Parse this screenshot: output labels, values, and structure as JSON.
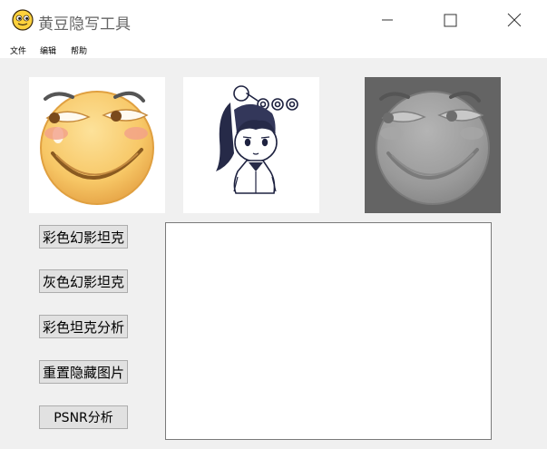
{
  "window": {
    "title": "黄豆隐写工具",
    "icon": "smiley-face-icon",
    "controls": [
      "minimize-icon",
      "maximize-icon",
      "close-icon"
    ]
  },
  "menu": {
    "items": [
      {
        "label": "文件"
      },
      {
        "label": "编辑"
      },
      {
        "label": "帮助"
      }
    ]
  },
  "images": [
    {
      "name": "cover-image-color-smiley",
      "icon": "smirk-emoji"
    },
    {
      "name": "hidden-image-anime-character",
      "icon": "anime-girl-sketch"
    },
    {
      "name": "result-image-gray-smiley",
      "icon": "smirk-emoji-gray"
    }
  ],
  "buttons": [
    {
      "label": "彩色幻影坦克"
    },
    {
      "label": "灰色幻影坦克"
    },
    {
      "label": "彩色坦克分析"
    },
    {
      "label": "重置隐藏图片"
    },
    {
      "label": "PSNR分析"
    }
  ],
  "output": {
    "text": ""
  },
  "colors": {
    "titlebar": "#ffffff",
    "window_bg": "#f0f0f0",
    "button_bg": "#e1e1e1",
    "gray_bg": "#646464",
    "smiley_yellow": "#f7c766"
  }
}
